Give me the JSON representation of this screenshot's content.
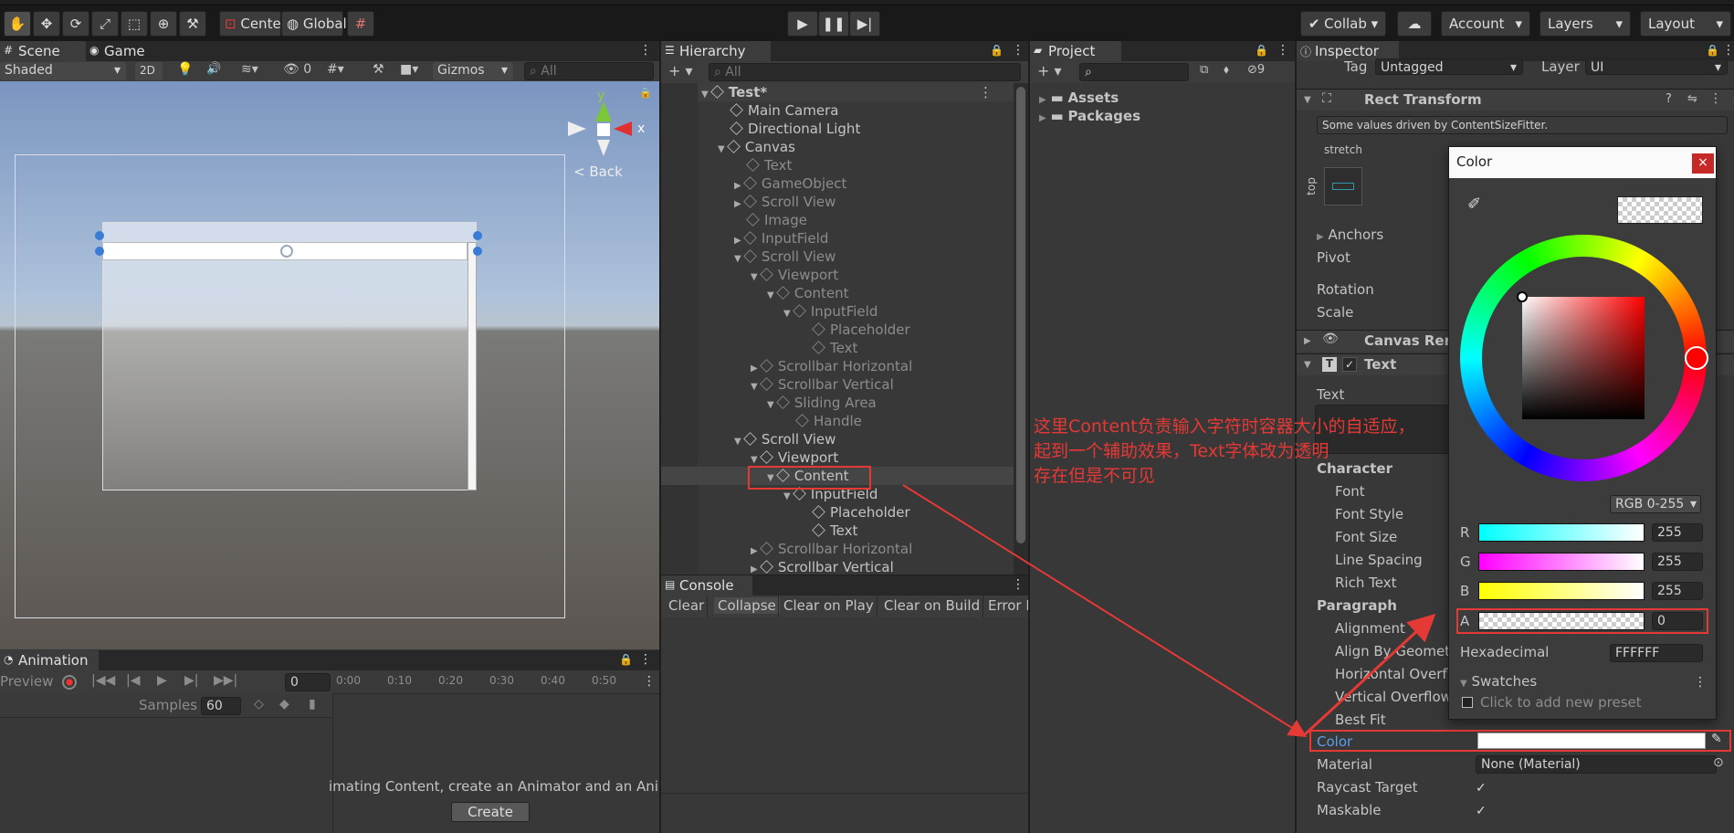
{
  "toolbar": {
    "pivot": "Center",
    "space": "Global",
    "collab": "Collab",
    "account": "Account",
    "layers": "Layers",
    "layout": "Layout"
  },
  "scene": {
    "tab_scene": "Scene",
    "tab_game": "Game",
    "shading": "Shaded",
    "mode2d": "2D",
    "fx_count": "0",
    "gizmos": "Gizmos",
    "search_placeholder": "All",
    "back": "Back",
    "axis_y": "y",
    "axis_x": "x"
  },
  "hierarchy": {
    "title": "Hierarchy",
    "search_placeholder": "All",
    "items": [
      "Test*",
      "Main Camera",
      "Directional Light",
      "Canvas",
      "Text",
      "GameObject",
      "Scroll View",
      "Image",
      "InputField",
      "Scroll View",
      "Viewport",
      "Content",
      "InputField",
      "Placeholder",
      "Text",
      "Scrollbar Horizontal",
      "Scrollbar Vertical",
      "Sliding Area",
      "Handle",
      "Scroll View",
      "Viewport",
      "Content",
      "InputField",
      "Placeholder",
      "Text",
      "Scrollbar Horizontal",
      "Scrollbar Vertical"
    ]
  },
  "project": {
    "title": "Project",
    "hidden_count": "9",
    "folders": [
      "Assets",
      "Packages"
    ]
  },
  "console": {
    "title": "Console",
    "buttons": [
      "Clear",
      "Collapse",
      "Clear on Play",
      "Clear on Build",
      "Error P"
    ]
  },
  "animation": {
    "title": "Animation",
    "preview": "Preview",
    "frame": "0",
    "samples_label": "Samples",
    "samples": "60",
    "ticks": [
      "0:00",
      "0:10",
      "0:20",
      "0:30",
      "0:40",
      "0:50"
    ],
    "message": "imating Content, create an Animator and an Ani",
    "create": "Create"
  },
  "inspector": {
    "title": "Inspector",
    "tag_label": "Tag",
    "tag": "Untagged",
    "layer_label": "Layer",
    "layer": "UI",
    "rect_transform": "Rect Transform",
    "driven_note": "Some values driven by ContentSizeFitter.",
    "stretch": "stretch",
    "top": "top",
    "anchors": "Anchors",
    "pivot": "Pivot",
    "rotation": "Rotation",
    "scale": "Scale",
    "canvas_renderer": "Canvas Rend",
    "text_component": "Text",
    "text_label": "Text",
    "character": "Character",
    "font": "Font",
    "font_style": "Font Style",
    "font_size": "Font Size",
    "line_spacing": "Line Spacing",
    "rich_text": "Rich Text",
    "paragraph": "Paragraph",
    "alignment": "Alignment",
    "align_by_geometry": "Align By Geometr",
    "horizontal_overflow": "Horizontal Overflo",
    "vertical_overflow": "Vertical Overflow",
    "best_fit": "Best Fit",
    "color": "Color",
    "material_label": "Material",
    "material": "None (Material)",
    "raycast_target": "Raycast Target",
    "maskable": "Maskable"
  },
  "color_picker": {
    "title": "Color",
    "mode": "RGB 0-255",
    "r_label": "R",
    "r": "255",
    "g_label": "G",
    "g": "255",
    "b_label": "B",
    "b": "255",
    "a_label": "A",
    "a": "0",
    "hex_label": "Hexadecimal",
    "hex": "FFFFFF",
    "swatches": "Swatches",
    "add_preset": "Click to add new preset",
    "close": "×"
  },
  "annotation": {
    "line1": "这里Content负责输入字符时容器大小的自适应，",
    "line2": "起到一个辅助效果，Text字体改为透明",
    "line3": "存在但是不可见"
  },
  "colors": {
    "annotation_red": "#e53935",
    "selection": "#2c5d87",
    "panel_bg": "#383838"
  }
}
